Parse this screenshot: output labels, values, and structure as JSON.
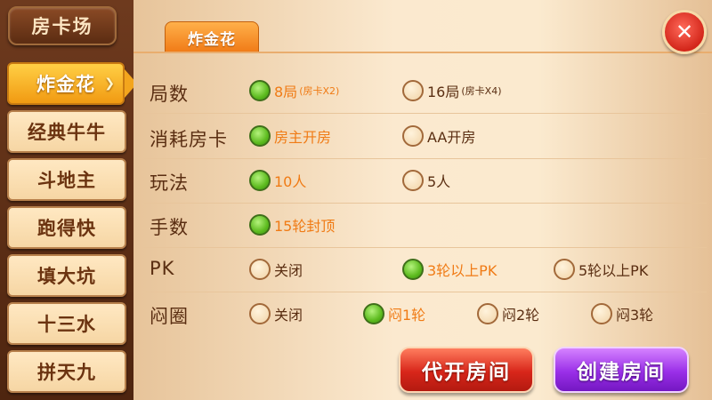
{
  "sidebar": {
    "title": "房卡场",
    "items": [
      {
        "label": "炸金花",
        "active": true
      },
      {
        "label": "经典牛牛",
        "active": false
      },
      {
        "label": "斗地主",
        "active": false
      },
      {
        "label": "跑得快",
        "active": false
      },
      {
        "label": "填大坑",
        "active": false
      },
      {
        "label": "十三水",
        "active": false
      },
      {
        "label": "拼天九",
        "active": false
      }
    ]
  },
  "tab": {
    "label": "炸金花"
  },
  "close": {
    "icon": "close-icon",
    "glyph": "✕"
  },
  "rows": [
    {
      "label": "局数",
      "options": [
        {
          "label": "8局",
          "sub": "(房卡X2)",
          "selected": true
        },
        {
          "label": "16局",
          "sub": "(房卡X4)",
          "selected": false
        }
      ]
    },
    {
      "label": "消耗房卡",
      "options": [
        {
          "label": "房主开房",
          "selected": true
        },
        {
          "label": "AA开房",
          "selected": false
        }
      ]
    },
    {
      "label": "玩法",
      "options": [
        {
          "label": "10人",
          "selected": true
        },
        {
          "label": "5人",
          "selected": false
        }
      ]
    },
    {
      "label": "手数",
      "options": [
        {
          "label": "15轮封顶",
          "selected": true
        }
      ]
    },
    {
      "label": "PK",
      "options": [
        {
          "label": "关闭",
          "selected": false
        },
        {
          "label": "3轮以上PK",
          "selected": true
        },
        {
          "label": "5轮以上PK",
          "selected": false
        }
      ]
    },
    {
      "label": "闷圈",
      "options": [
        {
          "label": "关闭",
          "selected": false
        },
        {
          "label": "闷1轮",
          "selected": true
        },
        {
          "label": "闷2轮",
          "selected": false
        },
        {
          "label": "闷3轮",
          "selected": false
        }
      ]
    }
  ],
  "buttons": {
    "proxy_open": "代开房间",
    "create": "创建房间"
  },
  "colors": {
    "selected_text": "#f07b15",
    "accent_green": "#5dbb1f",
    "sidebar_active": "#f19a12"
  }
}
